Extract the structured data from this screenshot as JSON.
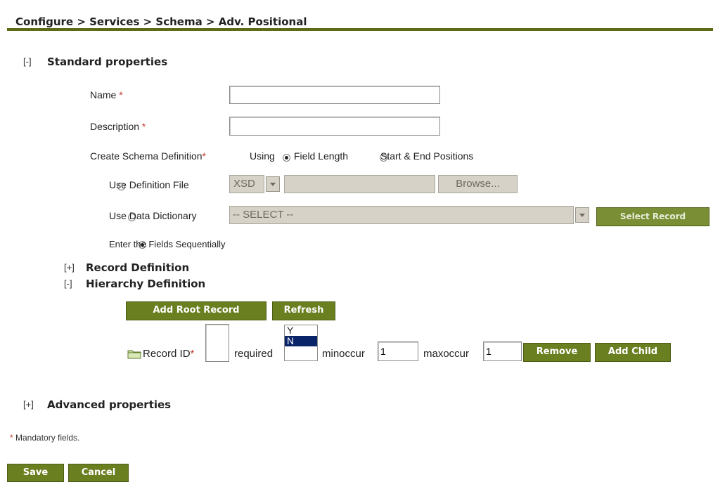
{
  "breadcrumb": "Configure > Services > Schema > Adv. Positional",
  "standard": {
    "toggle": "[-]",
    "title": "Standard properties",
    "name_label": "Name",
    "name_value": "",
    "description_label": "Description",
    "description_value": "",
    "required_mark": "*",
    "create_label": "Create Schema Definition",
    "using_label": "Using",
    "field_length_label": "Field Length",
    "start_end_label": "Start & End Positions",
    "use_def_file_label": "Use Definition File",
    "def_file_type": "XSD",
    "browse_label": "Browse...",
    "use_dict_label": "Use Data Dictionary",
    "dict_select_value": "-- SELECT --",
    "select_record_label": "Select Record",
    "enter_fields_label": "Enter the Fields Sequentially"
  },
  "record_def": {
    "toggle": "[+]",
    "title": "Record Definition"
  },
  "hierarchy": {
    "toggle": "[-]",
    "title": "Hierarchy Definition",
    "add_root_label": "Add Root Record",
    "refresh_label": "Refresh",
    "record_id_label": "Record ID",
    "record_id_value": "",
    "required_label": "required",
    "required_options": [
      "Y",
      "N"
    ],
    "required_selected": "N",
    "minoccur_label": "minoccur",
    "minoccur_value": "1",
    "maxoccur_label": "maxoccur",
    "maxoccur_value": "1",
    "remove_label": "Remove",
    "add_child_label": "Add Child"
  },
  "advanced": {
    "toggle": "[+]",
    "title": "Advanced properties"
  },
  "mandatory_note": "Mandatory fields.",
  "footer": {
    "save_label": "Save",
    "cancel_label": "Cancel"
  },
  "colors": {
    "accent": "#6a7f20",
    "rule": "#5b6b18",
    "required": "#c0392b",
    "selected": "#0a246a"
  }
}
